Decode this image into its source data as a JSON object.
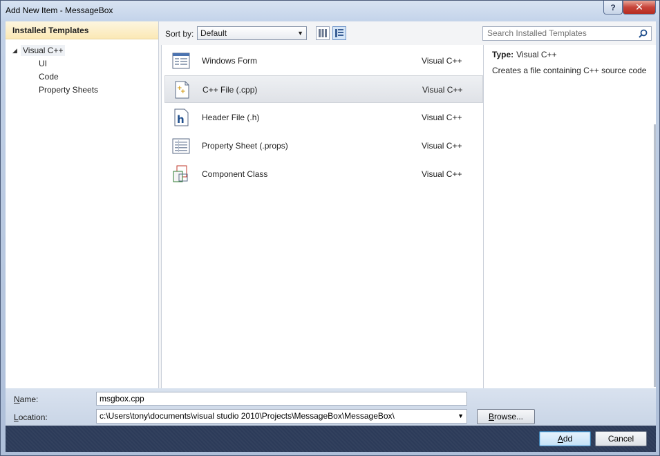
{
  "window": {
    "title": "Add New Item - MessageBox",
    "help_label": "?",
    "close_label": "✕"
  },
  "left": {
    "header": "Installed Templates",
    "root": "Visual C++",
    "children": [
      "UI",
      "Code",
      "Property Sheets"
    ]
  },
  "toolbar": {
    "sort_label": "Sort by:",
    "sort_value": "Default"
  },
  "search": {
    "placeholder": "Search Installed Templates"
  },
  "items": [
    {
      "name": "Windows Form",
      "lang": "Visual C++",
      "icon": "windows-form-icon"
    },
    {
      "name": "C++ File (.cpp)",
      "lang": "Visual C++",
      "icon": "cpp-file-icon"
    },
    {
      "name": "Header File (.h)",
      "lang": "Visual C++",
      "icon": "header-file-icon"
    },
    {
      "name": "Property Sheet (.props)",
      "lang": "Visual C++",
      "icon": "property-sheet-icon"
    },
    {
      "name": "Component Class",
      "lang": "Visual C++",
      "icon": "component-class-icon"
    }
  ],
  "selected_index": 1,
  "details": {
    "type_label": "Type:",
    "type_value": "Visual C++",
    "description": "Creates a file containing C++ source code"
  },
  "form": {
    "name_label_accel": "N",
    "name_label_rest": "ame:",
    "name_value": "msgbox.cpp",
    "location_label_accel": "L",
    "location_label_rest": "ocation:",
    "location_value": "c:\\Users\\tony\\documents\\visual studio 2010\\Projects\\MessageBox\\MessageBox\\",
    "browse_accel": "B",
    "browse_rest": "rowse..."
  },
  "buttons": {
    "add_accel": "A",
    "add_rest": "dd",
    "cancel": "Cancel"
  }
}
